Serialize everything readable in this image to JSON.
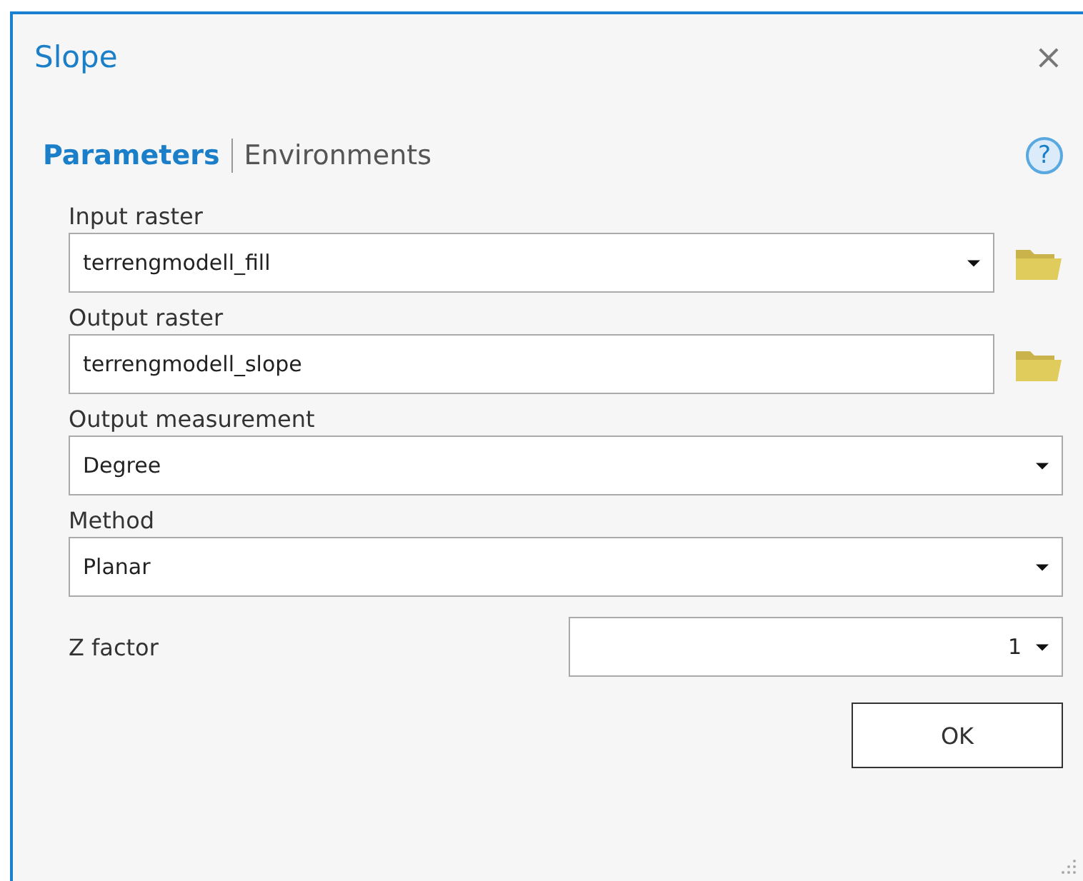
{
  "window": {
    "title": "Slope",
    "close": "×"
  },
  "tabs": [
    {
      "label": "Parameters",
      "selected": true
    },
    {
      "label": "Environments",
      "selected": false
    }
  ],
  "help": "?",
  "parameters": [
    {
      "kind": "dropdown-browse",
      "label": "Input raster",
      "value": "terrengmodell_fill"
    },
    {
      "kind": "text-browse",
      "label": "Output raster",
      "value": "terrengmodell_slope"
    },
    {
      "kind": "dropdown",
      "label": "Output measurement",
      "value": "Degree"
    },
    {
      "kind": "dropdown",
      "label": "Method",
      "value": "Planar"
    },
    {
      "kind": "inline-dropdown",
      "label": "Z factor",
      "value": "1"
    }
  ],
  "buttons": [
    "OK"
  ]
}
